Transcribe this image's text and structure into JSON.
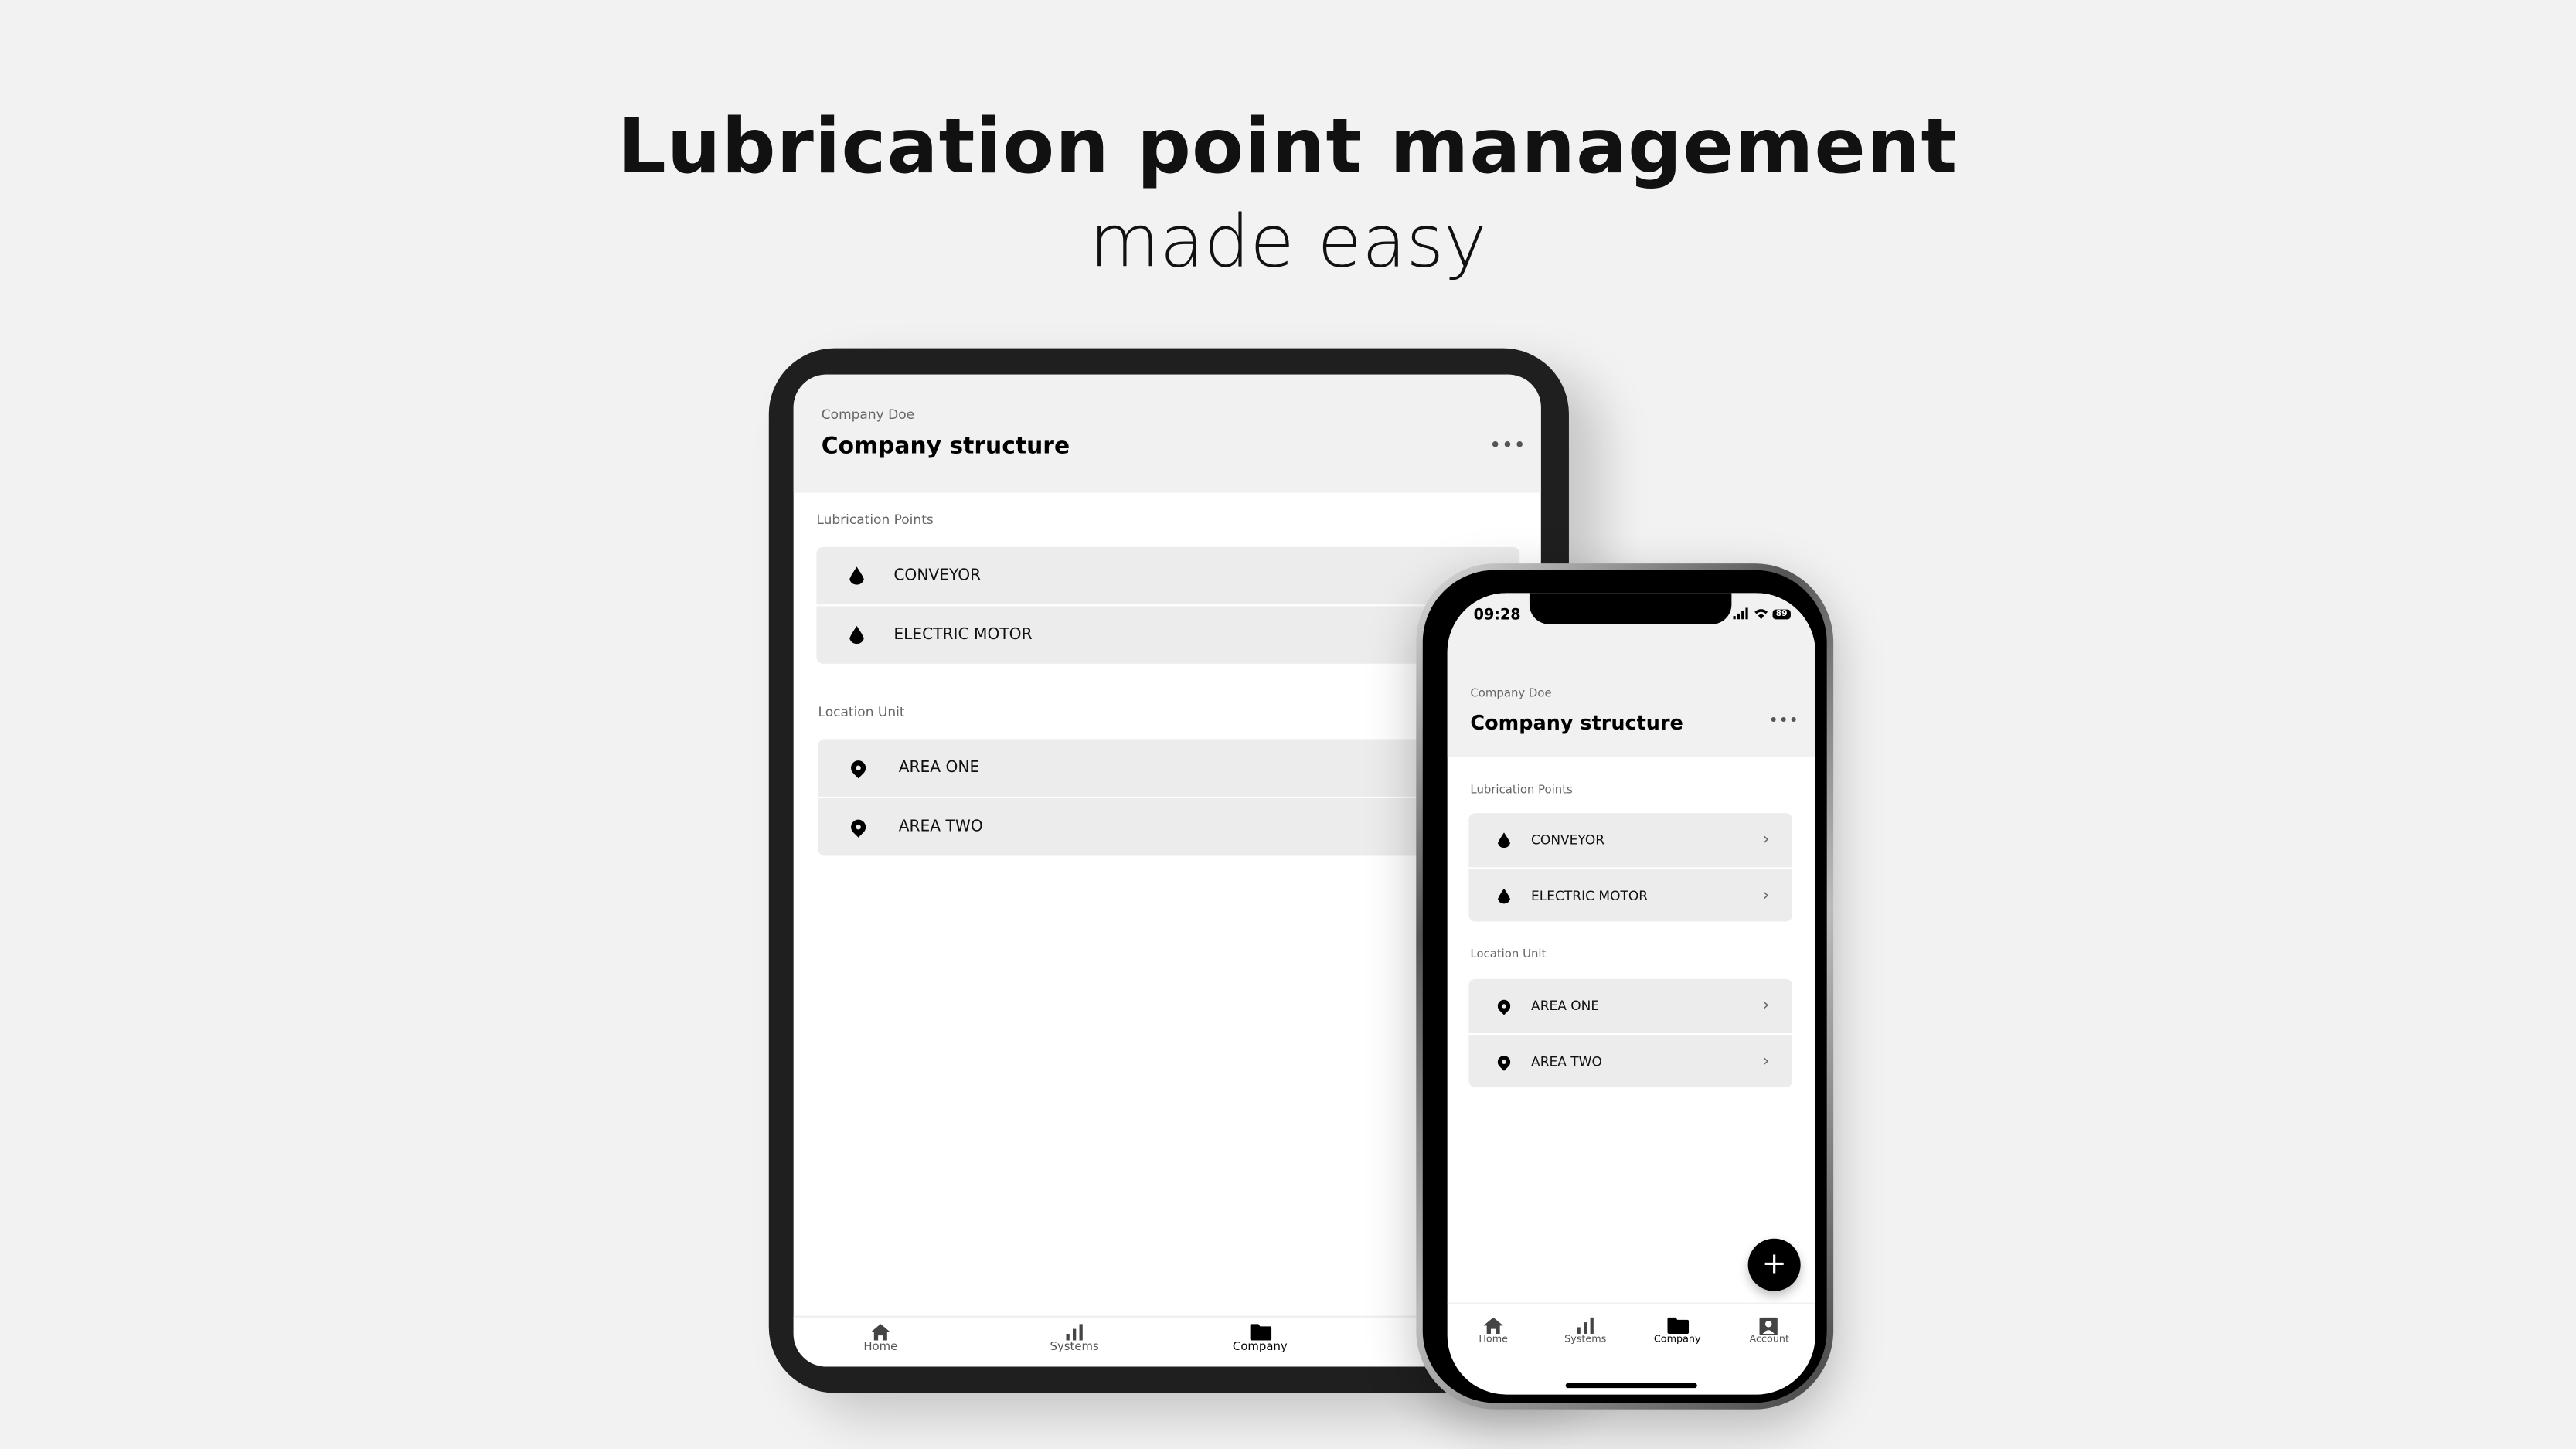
{
  "headline": {
    "title": "Lubrication point management",
    "subtitle": "made easy"
  },
  "app": {
    "company": "Company Doe",
    "title": "Company structure",
    "more_icon": "more-horizontal-icon",
    "sections": [
      {
        "label": "Lubrication Points",
        "icon": "oil-drop-icon",
        "items": [
          "CONVEYOR",
          "ELECTRIC MOTOR"
        ]
      },
      {
        "label": "Location Unit",
        "icon": "location-pin-icon",
        "items": [
          "AREA ONE",
          "AREA TWO"
        ]
      }
    ],
    "nav": [
      {
        "label": "Home",
        "icon": "home-icon"
      },
      {
        "label": "Systems",
        "icon": "bar-chart-icon"
      },
      {
        "label": "Company",
        "icon": "folder-icon",
        "active": true
      },
      {
        "label": "Account",
        "icon": "account-icon"
      }
    ],
    "fab": "+"
  },
  "status_bar": {
    "time": "09:28",
    "battery": "89"
  }
}
